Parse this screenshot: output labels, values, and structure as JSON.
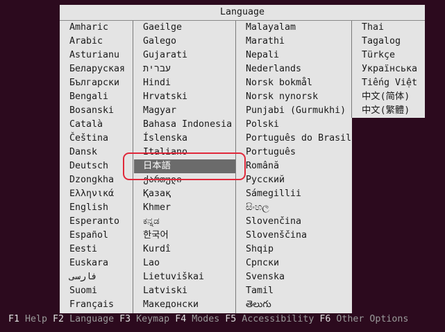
{
  "dialog": {
    "title": "Language"
  },
  "languages": {
    "col1": [
      "Amharic",
      "Arabic",
      "Asturianu",
      "Беларуская",
      "Български",
      "Bengali",
      "Bosanski",
      "Català",
      "Čeština",
      "Dansk",
      "Deutsch",
      "Dzongkha",
      "Ελληνικά",
      "English",
      "Esperanto",
      "Español",
      "Eesti",
      "Euskara",
      "فارسی",
      "Suomi",
      "Français"
    ],
    "col2": [
      "Gaeilge",
      "Galego",
      "Gujarati",
      "עברית",
      "Hindi",
      "Hrvatski",
      "Magyar",
      "Bahasa Indonesia",
      "Íslenska",
      "Italiano",
      "日本語",
      "ქართული",
      "Қазақ",
      "Khmer",
      "ಕನ್ನಡ",
      "한국어",
      "Kurdî",
      "Lao",
      "Lietuviškai",
      "Latviski",
      "Македонски"
    ],
    "col3": [
      "Malayalam",
      "Marathi",
      "Nepali",
      "Nederlands",
      "Norsk bokmål",
      "Norsk nynorsk",
      "Punjabi (Gurmukhi)",
      "Polski",
      "Português do Brasil",
      "Português",
      "Română",
      "Русский",
      "Sámegillii",
      "සිංහල",
      "Slovenčina",
      "Slovenščina",
      "Shqip",
      "Српски",
      "Svenska",
      "Tamil",
      "తెలుగు"
    ],
    "col4": [
      "Thai",
      "Tagalog",
      "Türkçe",
      "Українська",
      "Tiếng Việt",
      "中文(简体)",
      "中文(繁體)"
    ]
  },
  "selected_language": "日本語",
  "footer": [
    {
      "key": "F1",
      "label": "Help"
    },
    {
      "key": "F2",
      "label": "Language"
    },
    {
      "key": "F3",
      "label": "Keymap"
    },
    {
      "key": "F4",
      "label": "Modes"
    },
    {
      "key": "F5",
      "label": "Accessibility"
    },
    {
      "key": "F6",
      "label": "Other Options"
    }
  ],
  "colors": {
    "background": "#2c0a1e",
    "dialog": "#e4e4e4",
    "selection": "#6b6b6b",
    "annotation_ring": "#e0283a"
  }
}
